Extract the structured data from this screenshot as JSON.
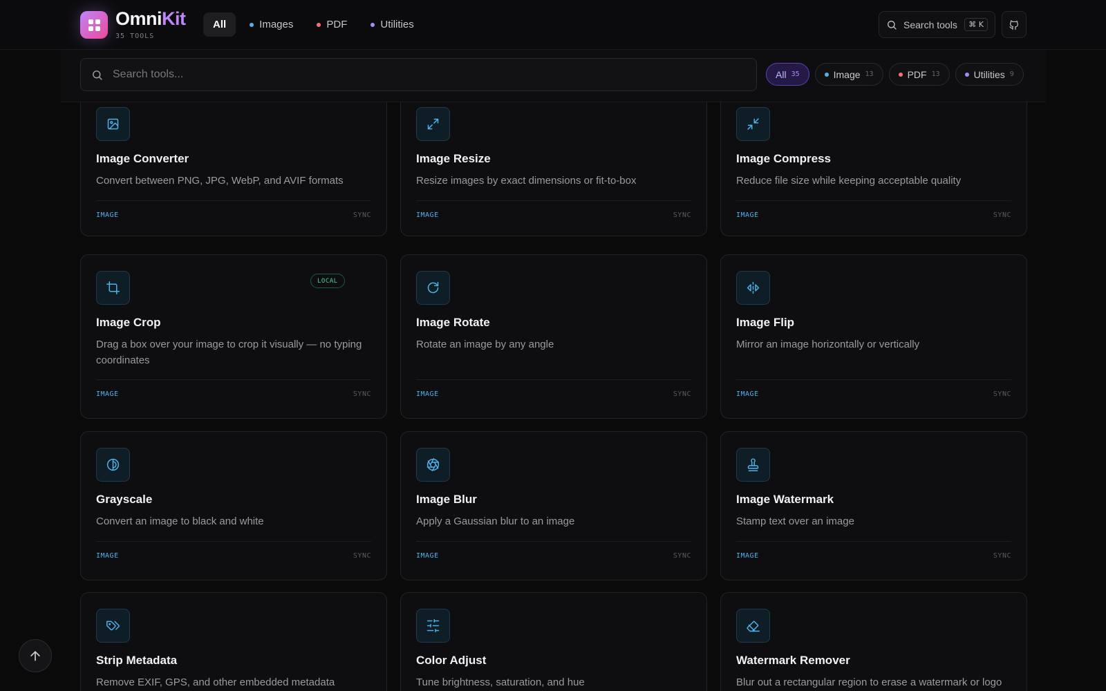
{
  "header": {
    "brand_part1": "Omni",
    "brand_part2": "Kit",
    "tool_count": "35 TOOLS",
    "nav": [
      {
        "label": "All",
        "active": true
      },
      {
        "label": "Images",
        "dot": "#4fb3e8"
      },
      {
        "label": "PDF",
        "dot": "#f87171"
      },
      {
        "label": "Utilities",
        "dot": "#a78bfa"
      }
    ],
    "search_label": "Search tools",
    "search_shortcut": "⌘ K",
    "github_icon": "github-icon"
  },
  "filter": {
    "placeholder": "Search tools...",
    "chips": [
      {
        "label": "All",
        "count": "35",
        "active": true
      },
      {
        "label": "Image",
        "count": "13",
        "dot": "#4fb3e8"
      },
      {
        "label": "PDF",
        "count": "13",
        "dot": "#f87171"
      },
      {
        "label": "Utilities",
        "count": "9",
        "dot": "#a78bfa"
      }
    ]
  },
  "cards": [
    {
      "title": "Image Converter",
      "desc": "Convert between PNG, JPG, WebP, and AVIF formats",
      "category": "IMAGE",
      "mode": "SYNC",
      "icon": "image-icon"
    },
    {
      "title": "Image Resize",
      "desc": "Resize images by exact dimensions or fit-to-box",
      "category": "IMAGE",
      "mode": "SYNC",
      "icon": "expand-icon"
    },
    {
      "title": "Image Compress",
      "desc": "Reduce file size while keeping acceptable quality",
      "category": "IMAGE",
      "mode": "SYNC",
      "icon": "compress-icon"
    },
    {
      "title": "Image Crop",
      "desc": "Drag a box over your image to crop it visually — no typing coordinates",
      "category": "IMAGE",
      "mode": "SYNC",
      "icon": "crop-icon",
      "badge": "LOCAL"
    },
    {
      "title": "Image Rotate",
      "desc": "Rotate an image by any angle",
      "category": "IMAGE",
      "mode": "SYNC",
      "icon": "rotate-icon"
    },
    {
      "title": "Image Flip",
      "desc": "Mirror an image horizontally or vertically",
      "category": "IMAGE",
      "mode": "SYNC",
      "icon": "flip-icon"
    },
    {
      "title": "Grayscale",
      "desc": "Convert an image to black and white",
      "category": "IMAGE",
      "mode": "SYNC",
      "icon": "contrast-icon"
    },
    {
      "title": "Image Blur",
      "desc": "Apply a Gaussian blur to an image",
      "category": "IMAGE",
      "mode": "SYNC",
      "icon": "aperture-icon"
    },
    {
      "title": "Image Watermark",
      "desc": "Stamp text over an image",
      "category": "IMAGE",
      "mode": "SYNC",
      "icon": "stamp-icon"
    },
    {
      "title": "Strip Metadata",
      "desc": "Remove EXIF, GPS, and other embedded metadata",
      "icon": "tags-icon"
    },
    {
      "title": "Color Adjust",
      "desc": "Tune brightness, saturation, and hue",
      "icon": "sliders-icon"
    },
    {
      "title": "Watermark Remover",
      "desc": "Blur out a rectangular region to erase a watermark or logo",
      "icon": "eraser-icon"
    }
  ],
  "back_to_top_icon": "arrow-up-icon"
}
